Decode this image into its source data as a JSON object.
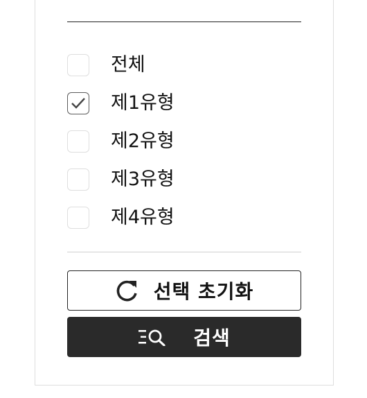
{
  "filter": {
    "options": [
      {
        "label": "전체",
        "checked": false
      },
      {
        "label": "제1유형",
        "checked": true
      },
      {
        "label": "제2유형",
        "checked": false
      },
      {
        "label": "제3유형",
        "checked": false
      },
      {
        "label": "제4유형",
        "checked": false
      }
    ],
    "reset_label": "선택 초기화",
    "search_label": "검색",
    "reset_icon": "refresh-icon",
    "search_icon": "search-list-icon"
  },
  "colors": {
    "search_button_bg": "#2a2a2a",
    "text": "#111111"
  }
}
